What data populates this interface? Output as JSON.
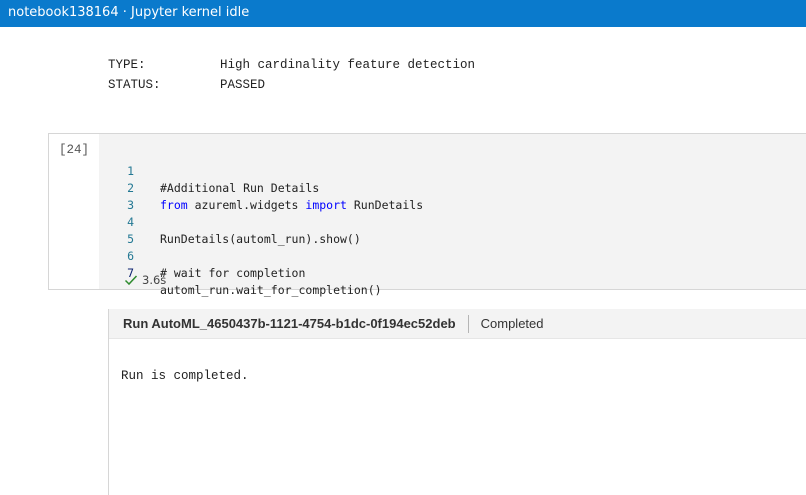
{
  "window": {
    "title": "notebook138164 · Jupyter kernel idle"
  },
  "previous_output": {
    "rows": [
      {
        "key": "TYPE:",
        "value": "High cardinality feature detection"
      },
      {
        "key": "STATUS:",
        "value": "PASSED"
      }
    ]
  },
  "cell": {
    "execution_count": "[24]",
    "lines": {
      "l1": {
        "num": "1",
        "text": "#Additional Run Details"
      },
      "l2": {
        "num": "2",
        "kw1": "from",
        "mid": " azureml.widgets ",
        "kw2": "import",
        "rest": " RunDetails"
      },
      "l3": {
        "num": "3",
        "text": ""
      },
      "l4": {
        "num": "4",
        "text": "RunDetails(automl_run).show()"
      },
      "l5": {
        "num": "5",
        "text": ""
      },
      "l6": {
        "num": "6",
        "text": "# wait for completion"
      },
      "l7": {
        "num": "7",
        "text": "automl_run.wait_for_completion()"
      }
    },
    "exec_time": "3.6s",
    "exec_icon": "check-icon",
    "accent_color": "#0a7acc",
    "success_color": "#2e8b2e"
  },
  "widget": {
    "run_title": "Run AutoML_4650437b-1121-4754-b1dc-0f194ec52deb",
    "status": "Completed",
    "message": "Run is completed."
  }
}
